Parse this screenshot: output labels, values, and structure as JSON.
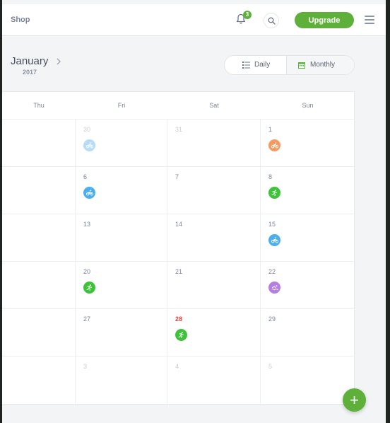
{
  "topbar": {
    "shop_label": "Shop",
    "notification_count": "3",
    "upgrade_label": "Upgrade",
    "icons": [
      "bell-icon",
      "search-icon",
      "hamburger-menu-icon"
    ]
  },
  "calendar_header": {
    "month": "January",
    "year": "2017",
    "next_icon": "chevron-right-icon",
    "view_options": [
      {
        "label": "Daily",
        "icon": "list-icon",
        "selected": false
      },
      {
        "label": "Monthly",
        "icon": "calendar-icon",
        "selected": true
      }
    ]
  },
  "colors": {
    "accent": "#5fb03a",
    "run": "#3ec23a",
    "cycle": "#4aaef0",
    "cycle_light": "#b8dcf7",
    "cycle_orange": "#f79a62",
    "swim": "#b67ee0",
    "today": "#e0453a"
  },
  "columns": [
    "Thu",
    "Fri",
    "Sat",
    "Sun"
  ],
  "weeks": [
    [
      {
        "day": ""
      },
      {
        "day": "30",
        "muted": true,
        "activity": "cycling-icon",
        "color": "#b8dcf7"
      },
      {
        "day": "31",
        "muted": true
      },
      {
        "day": "1",
        "activity": "cycling-icon",
        "color": "#f79a62"
      }
    ],
    [
      {
        "day": ""
      },
      {
        "day": "6",
        "activity": "cycling-icon",
        "color": "#4aaef0"
      },
      {
        "day": "7"
      },
      {
        "day": "8",
        "activity": "running-icon",
        "color": "#3ec23a"
      }
    ],
    [
      {
        "day": ""
      },
      {
        "day": "13"
      },
      {
        "day": "14"
      },
      {
        "day": "15",
        "activity": "cycling-icon",
        "color": "#4aaef0"
      }
    ],
    [
      {
        "day": ""
      },
      {
        "day": "20",
        "activity": "running-icon",
        "color": "#3ec23a"
      },
      {
        "day": "21"
      },
      {
        "day": "22",
        "activity": "swimming-icon",
        "color": "#b67ee0"
      }
    ],
    [
      {
        "day": ""
      },
      {
        "day": "27"
      },
      {
        "day": "28",
        "today": true,
        "activity": "running-icon",
        "color": "#3ec23a"
      },
      {
        "day": "29"
      }
    ],
    [
      {
        "day": ""
      },
      {
        "day": "3",
        "muted": true
      },
      {
        "day": "4",
        "muted": true
      },
      {
        "day": "5",
        "muted": true
      }
    ]
  ],
  "fab_label": "+"
}
